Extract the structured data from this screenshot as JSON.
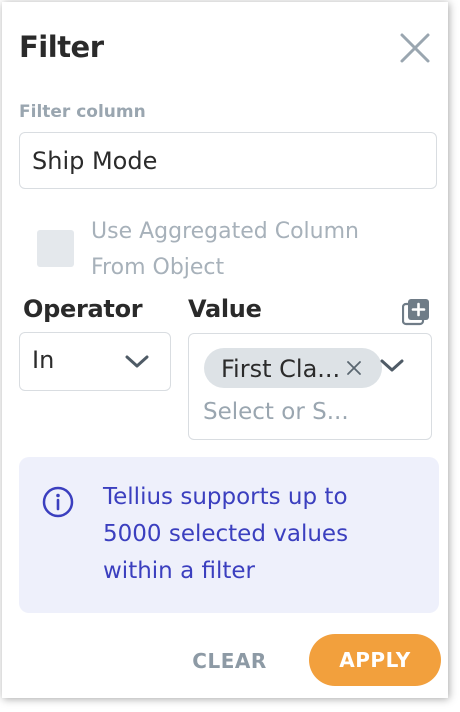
{
  "dialog": {
    "title": "Filter"
  },
  "filter_column": {
    "label": "Filter column",
    "value": "Ship Mode"
  },
  "aggregated": {
    "checked": false,
    "label_line1": "Use Aggregated Column",
    "label_line2": "From Object"
  },
  "operator": {
    "label": "Operator",
    "selected": "In"
  },
  "value": {
    "label": "Value",
    "chips": [
      "First Cla..."
    ],
    "placeholder": "Select or S..."
  },
  "info": {
    "text_line1": "Tellius supports up to",
    "text_line2": "5000 selected values",
    "text_line3": "within a filter"
  },
  "actions": {
    "clear_label": "CLEAR",
    "apply_label": "APPLY"
  },
  "colors": {
    "accent": "#f2a03d",
    "info_text": "#3b3fbf",
    "info_bg": "#eef0fb"
  },
  "icons": {
    "close": "close-icon",
    "chevron": "chevron-down-icon",
    "add": "add-filter-icon",
    "chip_remove": "remove-chip-icon",
    "info": "info-icon"
  }
}
